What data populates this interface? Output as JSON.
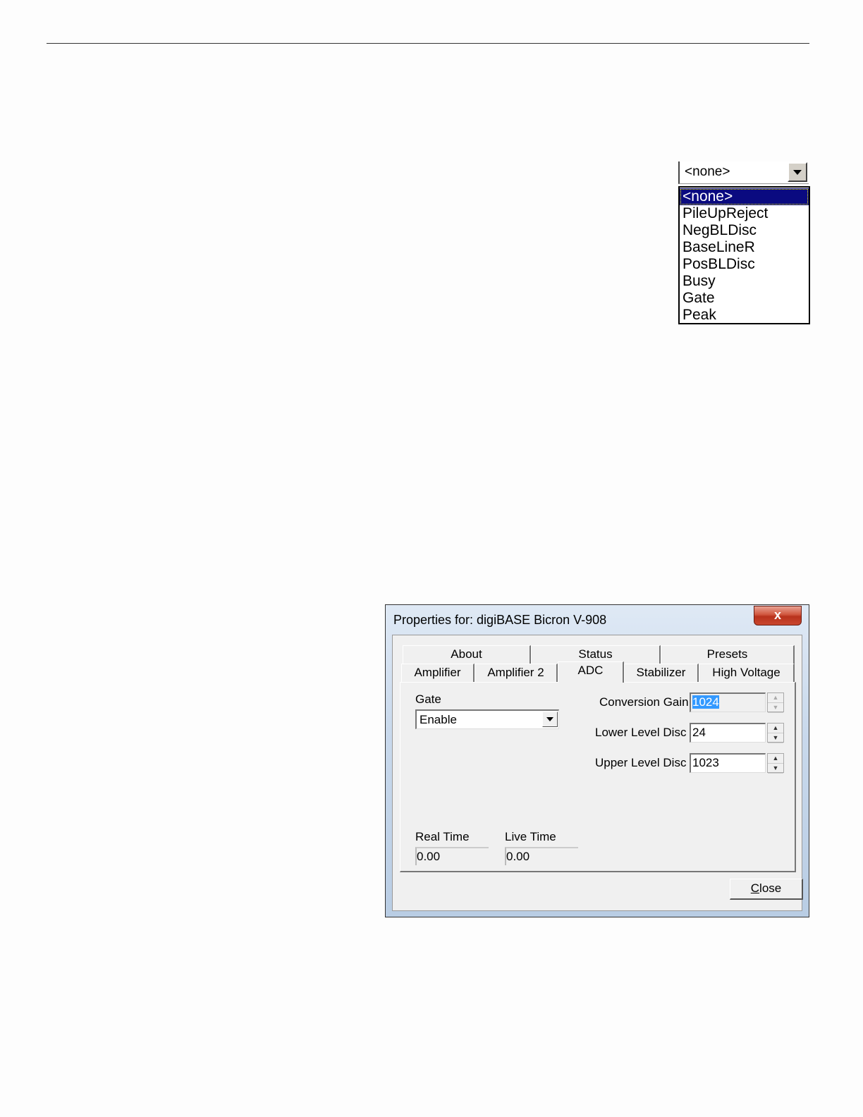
{
  "dropdown_figure": {
    "selected_value": "<none>",
    "options": [
      "<none>",
      "PileUpReject",
      "NegBLDisc",
      "BaseLineR",
      "PosBLDisc",
      "Busy",
      "Gate",
      "Peak"
    ]
  },
  "dialog": {
    "title": "Properties for: digiBASE Bicron V-908",
    "close_glyph": "x",
    "tabs_row1": [
      "About",
      "Status",
      "Presets"
    ],
    "tabs_row2": [
      "Amplifier",
      "Amplifier 2",
      "ADC",
      "Stabilizer",
      "High Voltage"
    ],
    "active_tab": "ADC",
    "gate": {
      "label": "Gate",
      "value": "Enable"
    },
    "conversion_gain": {
      "label": "Conversion Gain",
      "value": "1024"
    },
    "lower_level_disc": {
      "label": "Lower Level Disc",
      "value": "24"
    },
    "upper_level_disc": {
      "label": "Upper Level Disc",
      "value": "1023"
    },
    "real_time": {
      "label": "Real Time",
      "value": "0.00"
    },
    "live_time": {
      "label": "Live Time",
      "value": "0.00"
    },
    "close_button": {
      "mnemonic": "C",
      "rest": "lose"
    }
  }
}
